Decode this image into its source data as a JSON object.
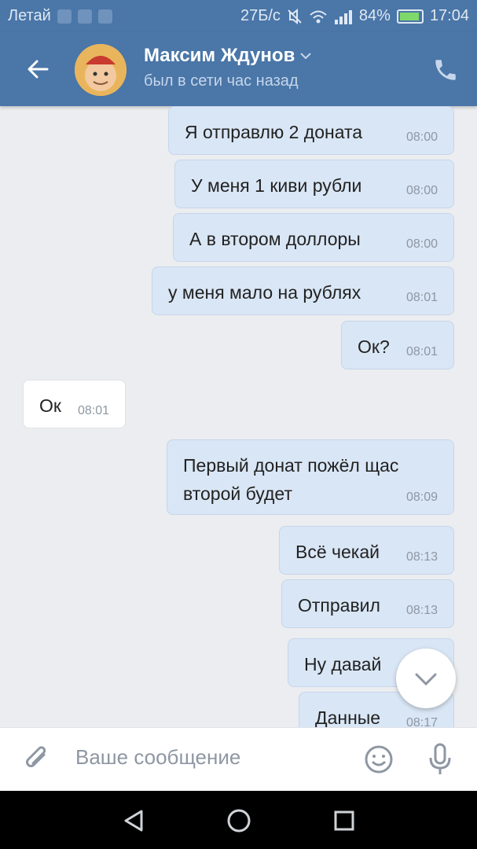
{
  "status": {
    "carrier": "Летай",
    "speed": "27Б/с",
    "battery": "84%",
    "time": "17:04"
  },
  "header": {
    "name": "Максим Ждунов",
    "status": "был в сети час назад"
  },
  "messages": [
    {
      "text": "Я отправлю 2 доната",
      "time": "08:00",
      "direction": "out"
    },
    {
      "text": "У меня 1 киви рубли",
      "time": "08:00",
      "direction": "out"
    },
    {
      "text": "А в втором доллоры",
      "time": "08:00",
      "direction": "out"
    },
    {
      "text": "у меня мало на рублях",
      "time": "08:01",
      "direction": "out"
    },
    {
      "text": "Ок?",
      "time": "08:01",
      "direction": "out"
    },
    {
      "text": "Ок",
      "time": "08:01",
      "direction": "in"
    },
    {
      "text": "Первый донат пожёл щас\nвторой будет",
      "time": "08:09",
      "direction": "out"
    },
    {
      "text": "Всё чекай",
      "time": "08:13",
      "direction": "out"
    },
    {
      "text": "Отправил",
      "time": "08:13",
      "direction": "out"
    },
    {
      "text": "Ну давай",
      "time": "",
      "direction": "out"
    },
    {
      "text": "Данные",
      "time": "08:17",
      "direction": "out"
    }
  ],
  "composer": {
    "placeholder": "Ваше сообщение"
  },
  "colors": {
    "accent": "#4a76a8",
    "outgoing_bubble": "#d9e6f5",
    "incoming_bubble": "#ffffff",
    "chat_bg": "#ebedf0"
  }
}
